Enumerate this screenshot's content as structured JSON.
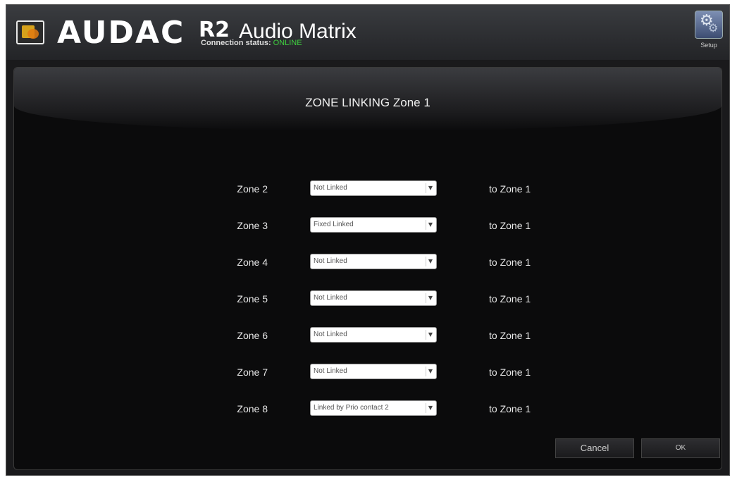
{
  "header": {
    "brand": "AUDAC",
    "model": "R2",
    "product": "Audio Matrix",
    "connection_label": "Connection status:",
    "connection_status": "ONLINE",
    "setup_label": "Setup"
  },
  "dialog": {
    "title": "ZONE LINKING Zone 1",
    "rows": [
      {
        "zone": "Zone 2",
        "link": "Not Linked",
        "target": "to Zone 1"
      },
      {
        "zone": "Zone 3",
        "link": "Fixed Linked",
        "target": "to Zone 1"
      },
      {
        "zone": "Zone 4",
        "link": "Not Linked",
        "target": "to Zone 1"
      },
      {
        "zone": "Zone 5",
        "link": "Not Linked",
        "target": "to Zone 1"
      },
      {
        "zone": "Zone 6",
        "link": "Not Linked",
        "target": "to Zone 1"
      },
      {
        "zone": "Zone 7",
        "link": "Not Linked",
        "target": "to Zone 1"
      },
      {
        "zone": "Zone 8",
        "link": "Linked by Prio contact 2",
        "target": "to Zone 1"
      }
    ],
    "cancel_label": "Cancel",
    "ok_label": "OK"
  },
  "icons": {
    "logo": "audac-logo-icon",
    "setup": "gear-icon",
    "dropdown": "chevron-down-icon"
  },
  "colors": {
    "online": "#3fd13f",
    "background": "#0b0b0c"
  }
}
